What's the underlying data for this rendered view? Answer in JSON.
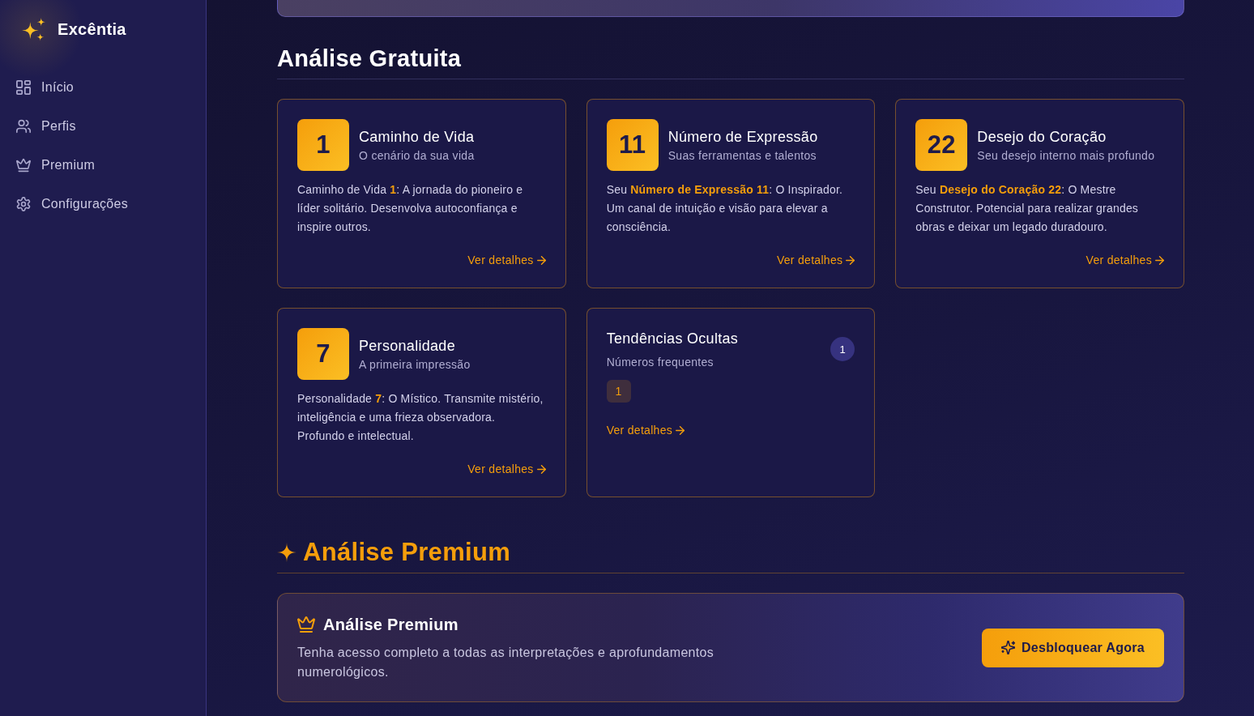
{
  "sidebar": {
    "brand": "Excêntia",
    "items": [
      {
        "label": "Início",
        "selected": false
      },
      {
        "label": "Perfis",
        "selected": false
      },
      {
        "label": "Premium",
        "selected": false
      },
      {
        "label": "Configurações",
        "selected": false
      }
    ]
  },
  "free_analysis": {
    "title": "Análise Gratuita",
    "cards": [
      {
        "kind": "number",
        "number": "1",
        "title": "Caminho de Vida",
        "subtitle": "O cenário da sua vida",
        "description": "Caminho de Vida **1**: A jornada do pioneiro e líder solitário. Desenvolva autoconfiança e inspire outros.",
        "link": "Ver detalhes"
      },
      {
        "kind": "number",
        "number": "11",
        "title": "Número de Expressão",
        "subtitle": "Suas ferramentas e talentos",
        "description": "Seu **Número de Expressão 11**: O Inspirador. Um canal de intuição e visão para elevar a consciência.",
        "link": "Ver detalhes"
      },
      {
        "kind": "number",
        "number": "22",
        "title": "Desejo do Coração",
        "subtitle": "Seu desejo interno mais profundo",
        "description": "Seu **Desejo do Coração 22**: O Mestre Construtor. Potencial para realizar grandes obras e deixar um legado duradouro.",
        "link": "Ver detalhes"
      },
      {
        "kind": "number",
        "number": "7",
        "title": "Personalidade",
        "subtitle": "A primeira impressão",
        "description": "Personalidade **7**: O Místico. Transmite mistério, inteligência e uma frieza observadora. Profundo e intelectual.",
        "link": "Ver detalhes"
      },
      {
        "kind": "list",
        "title": "Tendências Ocultas",
        "subtitle": "Números frequentes",
        "count": "1",
        "numbers": [
          "1"
        ],
        "link": "Ver detalhes"
      }
    ]
  },
  "premium_analysis": {
    "title": "Análise Premium",
    "card": {
      "title": "Análise Premium",
      "description": "Tenha acesso completo a todas as interpretações e aprofundamentos numerológicos.",
      "button": "Desbloquear Agora"
    }
  }
}
